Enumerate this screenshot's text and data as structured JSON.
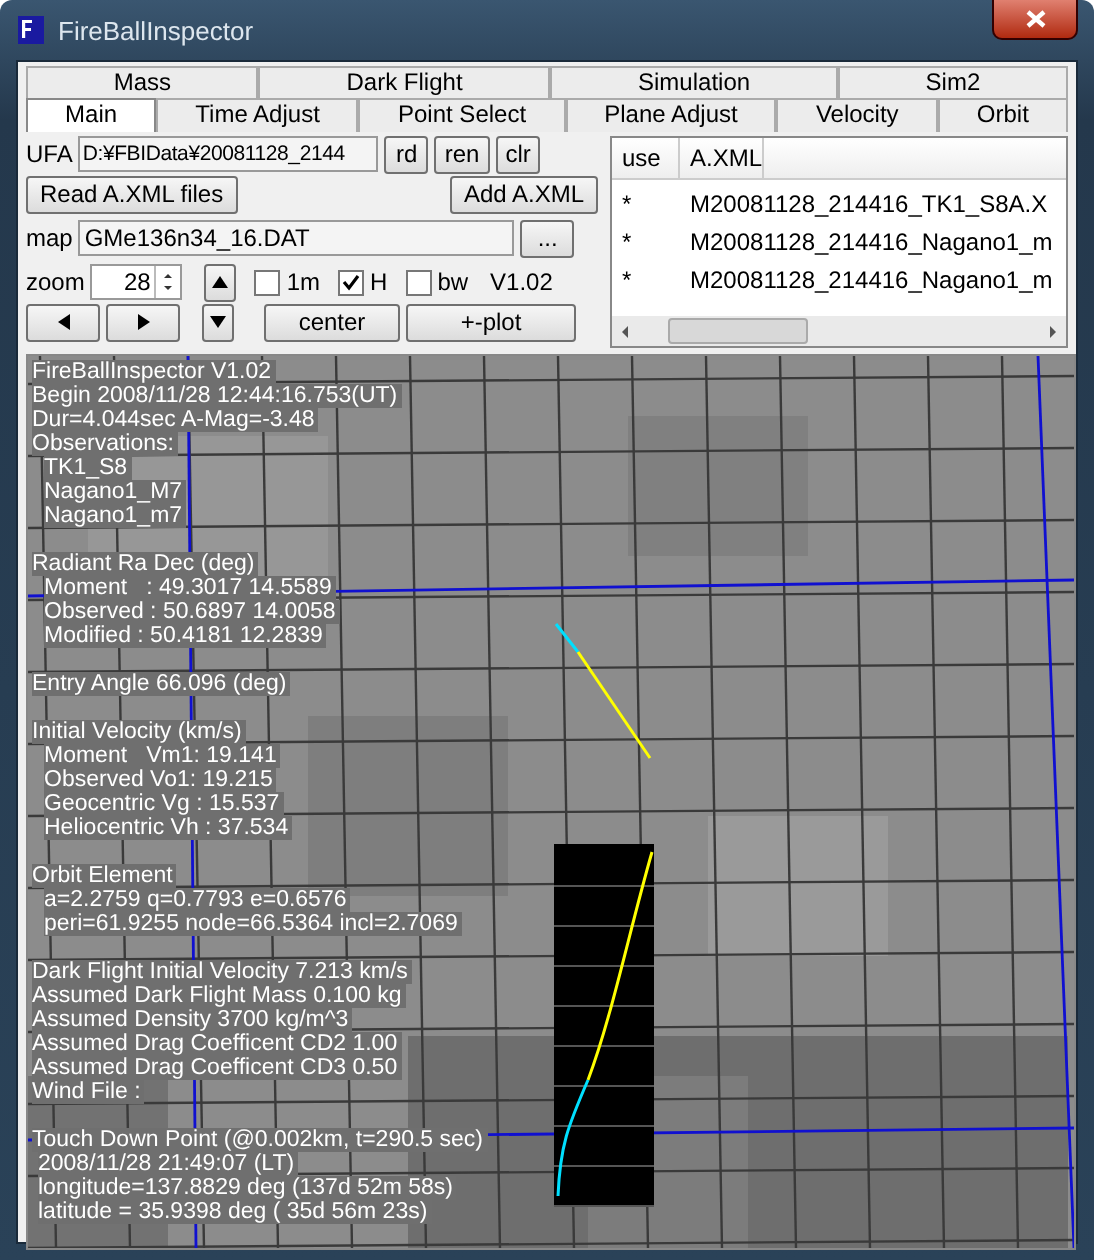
{
  "window": {
    "title": "FireBallInspector"
  },
  "tab_rows": [
    [
      {
        "label": "Mass",
        "selected": false
      },
      {
        "label": "Dark Flight",
        "selected": false
      },
      {
        "label": "Simulation",
        "selected": false
      },
      {
        "label": "Sim2",
        "selected": false
      }
    ],
    [
      {
        "label": "Main",
        "selected": true
      },
      {
        "label": "Time Adjust",
        "selected": false
      },
      {
        "label": "Point Select",
        "selected": false
      },
      {
        "label": "Plane Adjust",
        "selected": false
      },
      {
        "label": "Velocity",
        "selected": false
      },
      {
        "label": "Orbit",
        "selected": false
      }
    ]
  ],
  "ufa": {
    "label": "UFA",
    "value": "D:¥FBIData¥20081128_2144",
    "buttons": [
      "rd",
      "ren",
      "clr"
    ]
  },
  "read_button": "Read A.XML files",
  "add_button": "Add A.XML",
  "map_file": {
    "label": "map",
    "value": "GMe136n34_16.DAT",
    "browse": "..."
  },
  "zoom": {
    "label": "zoom",
    "value": "28"
  },
  "checkboxes": [
    {
      "label": "1m",
      "checked": false
    },
    {
      "label": "H",
      "checked": true
    },
    {
      "label": "bw",
      "checked": false
    }
  ],
  "version": "V1.02",
  "center_button": "center",
  "plot_button": "+-plot",
  "file_list": {
    "columns": [
      "use",
      "A.XML"
    ],
    "rows": [
      {
        "use": "*",
        "file": "M20081128_214416_TK1_S8A.X"
      },
      {
        "use": "*",
        "file": "M20081128_214416_Nagano1_m"
      },
      {
        "use": "*",
        "file": "M20081128_214416_Nagano1_m"
      }
    ]
  },
  "info_blocks": [
    [
      {
        "kind": "head",
        "text": "FireBallInspector V1.02"
      },
      {
        "kind": "head",
        "text": "Begin 2008/11/28 12:44:16.753(UT)"
      },
      {
        "kind": "head",
        "text": "Dur=4.044sec A-Mag=-3.48"
      },
      {
        "kind": "head",
        "text": "Observations:"
      },
      {
        "kind": "item",
        "text": "TK1_S8"
      },
      {
        "kind": "item",
        "text": "Nagano1_M7"
      },
      {
        "kind": "item",
        "text": "Nagano1_m7"
      }
    ],
    [
      {
        "kind": "head",
        "text": "Radiant Ra Dec (deg)"
      },
      {
        "kind": "item",
        "text": "Moment   : 49.3017 14.5589"
      },
      {
        "kind": "item",
        "text": "Observed : 50.6897 14.0058"
      },
      {
        "kind": "item",
        "text": "Modified : 50.4181 12.2839"
      }
    ],
    [
      {
        "kind": "head",
        "text": "Entry Angle 66.096 (deg)"
      }
    ],
    [
      {
        "kind": "head",
        "text": "Initial Velocity (km/s)"
      },
      {
        "kind": "item",
        "text": "Moment   Vm1: 19.141"
      },
      {
        "kind": "item",
        "text": "Observed Vo1: 19.215"
      },
      {
        "kind": "item",
        "text": "Geocentric Vg : 15.537"
      },
      {
        "kind": "item",
        "text": "Heliocentric Vh : 37.534"
      }
    ],
    [
      {
        "kind": "head",
        "text": "Orbit Element"
      },
      {
        "kind": "item",
        "text": "a=2.2759 q=0.7793 e=0.6576"
      },
      {
        "kind": "item",
        "text": "peri=61.9255 node=66.5364 incl=2.7069"
      }
    ],
    [
      {
        "kind": "head",
        "text": "Dark Flight Initial Velocity 7.213 km/s"
      },
      {
        "kind": "head",
        "text": "Assumed Dark Flight Mass 0.100 kg"
      },
      {
        "kind": "head",
        "text": "Assumed Density 3700 kg/m^3"
      },
      {
        "kind": "head",
        "text": "Assumed Drag Coefficent CD2 1.00"
      },
      {
        "kind": "head",
        "text": "Assumed Drag Coefficent CD3 0.50"
      },
      {
        "kind": "head",
        "text": "Wind File :"
      }
    ],
    [
      {
        "kind": "head",
        "text": "Touch Down Point (@0.002km, t=290.5 sec)"
      },
      {
        "kind": "sub",
        "text": "2008/11/28 21:49:07 (LT)"
      },
      {
        "kind": "sub",
        "text": "longitude=137.8829 deg (137d 52m 58s)"
      },
      {
        "kind": "sub",
        "text": "latitude = 35.9398 deg ( 35d 56m 23s)"
      }
    ]
  ]
}
